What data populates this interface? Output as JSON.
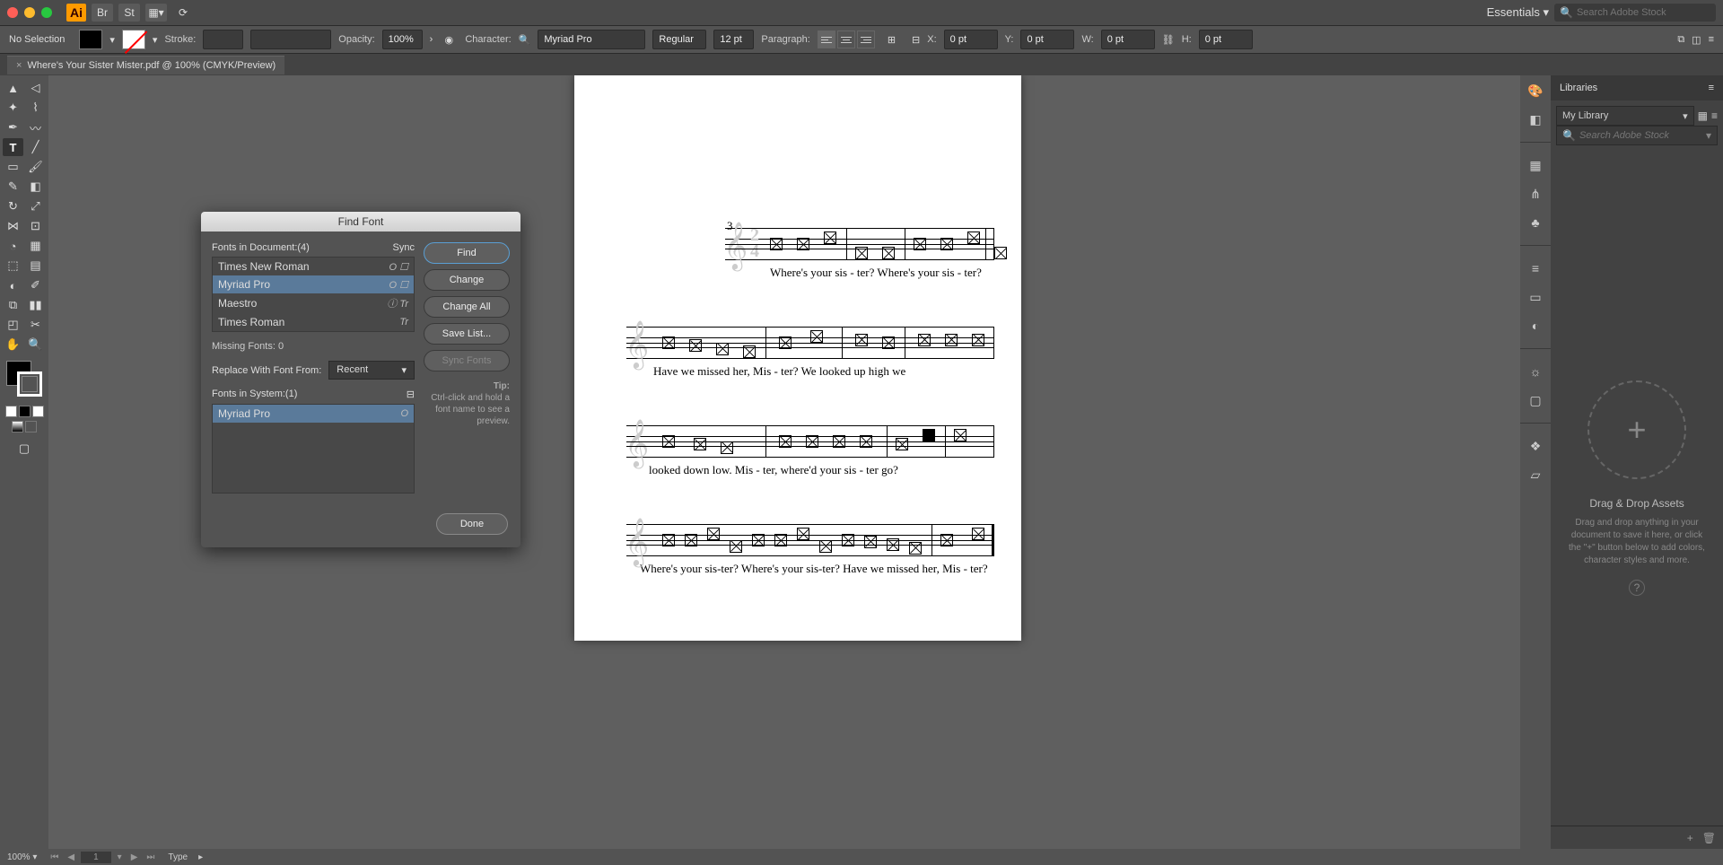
{
  "menubar": {
    "essentials": "Essentials",
    "search_placeholder": "Search Adobe Stock"
  },
  "control": {
    "selection": "No Selection",
    "stroke_label": "Stroke:",
    "opacity_label": "Opacity:",
    "opacity_value": "100%",
    "character_label": "Character:",
    "font": "Myriad Pro",
    "weight": "Regular",
    "size": "12 pt",
    "paragraph_label": "Paragraph:",
    "x_label": "X:",
    "x_value": "0 pt",
    "y_label": "Y:",
    "y_value": "0 pt",
    "w_label": "W:",
    "w_value": "0 pt",
    "h_label": "H:",
    "h_value": "0 pt"
  },
  "tab": {
    "title": "Where's Your Sister Mister.pdf @ 100% (CMYK/Preview)"
  },
  "dialog": {
    "title": "Find Font",
    "fonts_in_doc_label": "Fonts in Document:(4)",
    "sync_label": "Sync",
    "doc_fonts": [
      {
        "name": "Times New Roman",
        "type": "O"
      },
      {
        "name": "Myriad Pro",
        "type": "O"
      },
      {
        "name": "Maestro",
        "type": "Tr"
      },
      {
        "name": "Times Roman",
        "type": "Tr"
      }
    ],
    "missing_label": "Missing Fonts: 0",
    "replace_label": "Replace With Font From:",
    "replace_source": "Recent",
    "system_label": "Fonts in System:(1)",
    "system_fonts": [
      {
        "name": "Myriad Pro",
        "type": "O"
      }
    ],
    "btn_find": "Find",
    "btn_change": "Change",
    "btn_change_all": "Change All",
    "btn_save": "Save List...",
    "btn_sync": "Sync Fonts",
    "tip_title": "Tip:",
    "tip_body": "Ctrl-click and hold a font name to see a preview.",
    "done": "Done"
  },
  "libraries": {
    "title": "Libraries",
    "my_library": "My Library",
    "search_placeholder": "Search Adobe Stock",
    "drop_title": "Drag & Drop Assets",
    "drop_body": "Drag and drop anything in your document to save it here, or click the \"+\" button below to add colors, character styles and more."
  },
  "lyrics": {
    "l1": "Where's   your     sis  -  ter?      Where's  your  sis  -  ter?",
    "l2": "Have   we   missed   her,     Mis  -  ter?          We     looked   up   high   we",
    "l3": "looked   down   low.             Mis  -  ter,   where'd   your     sis  -  ter      go?",
    "l4": "Where's your sis-ter?  Where's your sis-ter?  Have we missed her, Mis    -     ter?"
  },
  "triplet": "3",
  "status": {
    "zoom": "100%",
    "page": "1",
    "mode": "Type"
  }
}
